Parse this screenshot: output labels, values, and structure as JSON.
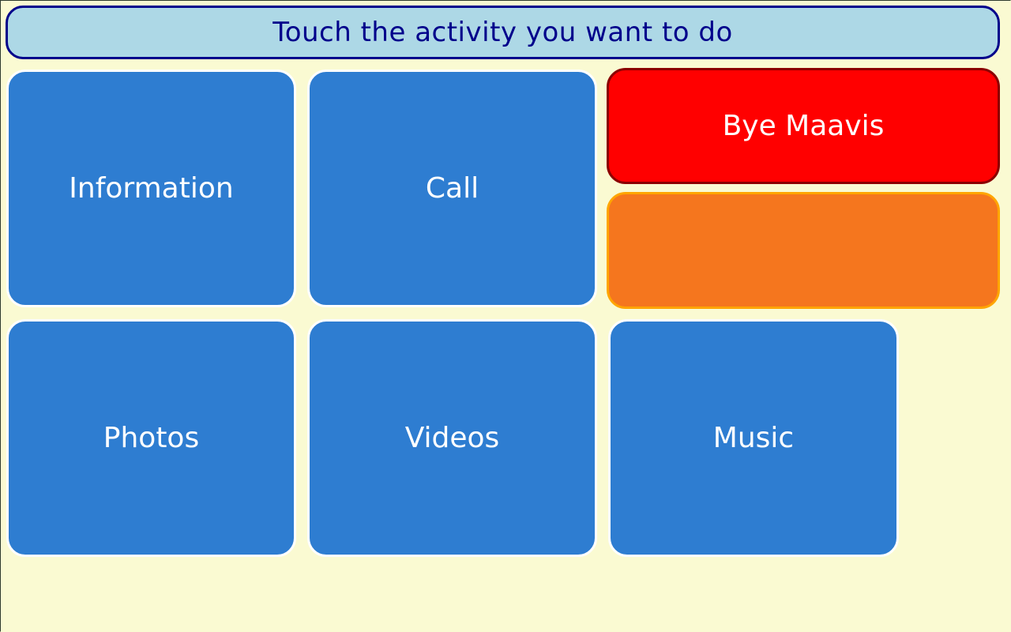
{
  "header": {
    "title": "Touch the activity you want to do"
  },
  "tiles": {
    "information": "Information",
    "call": "Call",
    "bye": "Bye Maavis",
    "blank": "",
    "photos": "Photos",
    "videos": "Videos",
    "music": "Music"
  },
  "colors": {
    "background": "#fafad2",
    "header_fill": "#add8e6",
    "header_text": "#00008b",
    "tile_blue": "#2e7dd1",
    "tile_red": "#ff0000",
    "tile_orange": "#f5761e"
  }
}
